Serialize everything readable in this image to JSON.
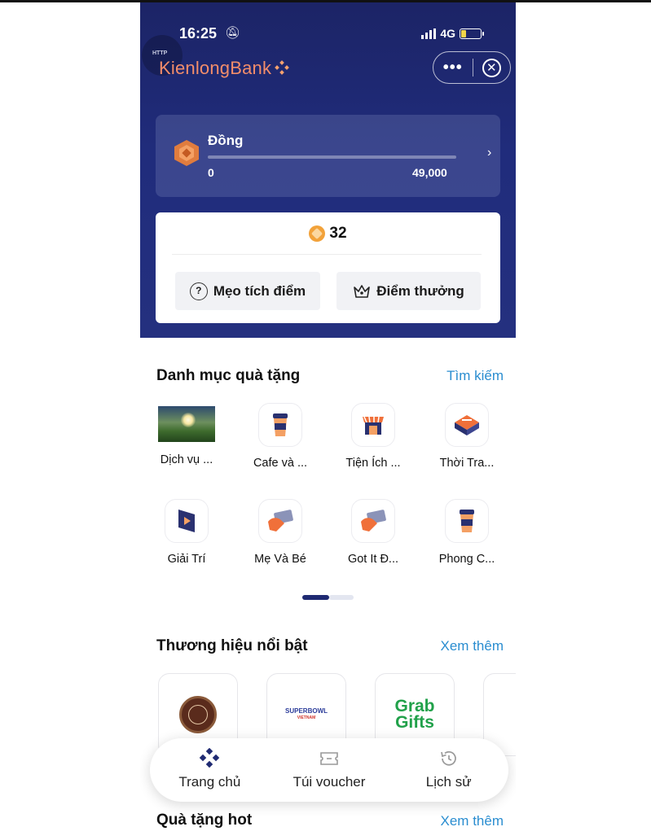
{
  "status_bar": {
    "time": "16:25",
    "network": "4G"
  },
  "header": {
    "http_badge": "HTTP",
    "logo_text": "KienlongBank",
    "more_icon": "more-dots-icon",
    "close_icon": "close-circle-icon"
  },
  "tier": {
    "name": "Đồng",
    "min": "0",
    "max": "49,000",
    "progress": 0
  },
  "points": {
    "value": "32",
    "tips_label": "Mẹo tích điểm",
    "reward_label": "Điểm thưởng"
  },
  "categories_section": {
    "title": "Danh mục quà tặng",
    "link": "Tìm kiếm",
    "items": [
      {
        "label": "Dịch vụ ...",
        "icon": "landscape-photo"
      },
      {
        "label": "Cafe và ...",
        "icon": "cup-icon"
      },
      {
        "label": "Tiện Ích ...",
        "icon": "store-icon"
      },
      {
        "label": "Thời Tra...",
        "icon": "shopping-bag-icon"
      },
      {
        "label": "Giải Trí",
        "icon": "play-icon"
      },
      {
        "label": "Mẹ Và Bé",
        "icon": "card-hand-icon"
      },
      {
        "label": "Got It Đ...",
        "icon": "card-hand-icon"
      },
      {
        "label": "Phong C...",
        "icon": "cup-icon"
      }
    ]
  },
  "brands_section": {
    "title": "Thương hiệu nổi bật",
    "link": "Xem thêm",
    "brands": [
      {
        "name": "coffee-bean-logo"
      },
      {
        "name": "SUPERBOWL",
        "sub": "VIETNAM"
      },
      {
        "name": "Grab Gifts",
        "line1": "Grab",
        "line2": "Gifts"
      }
    ]
  },
  "bottom_nav": [
    {
      "label": "Trang chủ",
      "icon": "home-diamond-icon"
    },
    {
      "label": "Túi voucher",
      "icon": "voucher-icon"
    },
    {
      "label": "Lịch sử",
      "icon": "history-icon"
    }
  ],
  "hot_section": {
    "title": "Quà tặng hot",
    "link": "Xem thêm"
  },
  "colors": {
    "hero": "#1c2466",
    "accent_link": "#2a8dd0",
    "logo": "#f38d6a",
    "coin": "#f2a23a",
    "grab": "#21a14a"
  }
}
